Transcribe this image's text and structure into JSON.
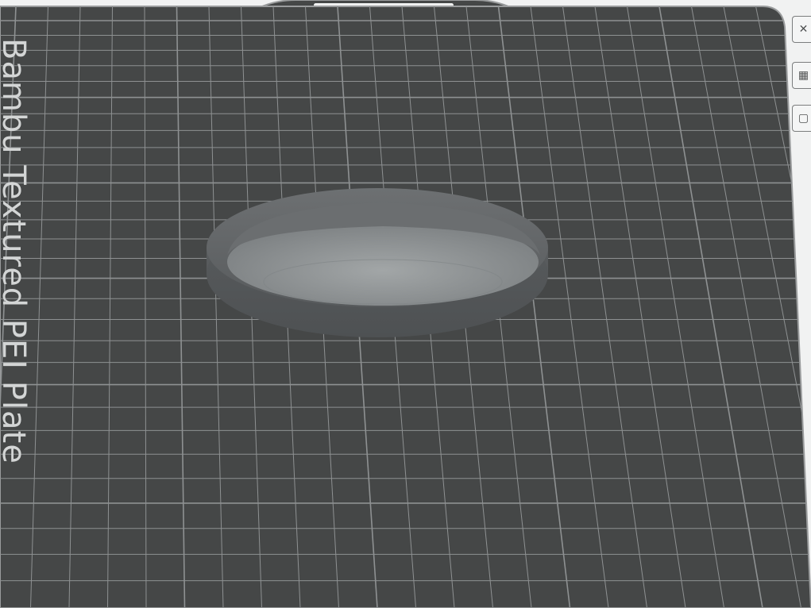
{
  "app": {
    "view": "3D plate preview"
  },
  "plate": {
    "label": "Bambu Textured PEI Plate",
    "surface_color": "#454747",
    "grid_color": "#8e9192",
    "border_color": "#9a9c9d",
    "background_color": "#f1f2f2"
  },
  "model": {
    "color": "#5f6264",
    "rim_color": "#6c6f71",
    "inner_color": "#8f9394"
  },
  "toolbar": {
    "buttons": [
      {
        "name": "close-plate-button",
        "icon": "close-icon",
        "glyph": "✕"
      },
      {
        "name": "auto-arrange-button",
        "icon": "arrange-icon",
        "glyph": "▦"
      },
      {
        "name": "plate-settings-button",
        "icon": "settings-icon",
        "glyph": "▢"
      }
    ]
  }
}
